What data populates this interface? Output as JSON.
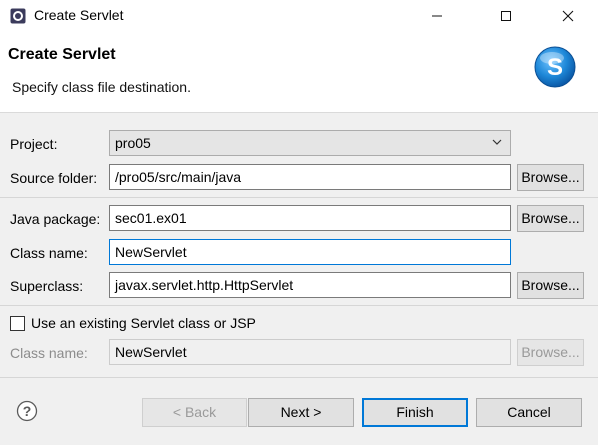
{
  "window": {
    "title": "Create Servlet",
    "app_icon": "eclipse-icon",
    "controls": [
      "minimize-icon",
      "maximize-icon",
      "close-icon"
    ]
  },
  "header": {
    "title": "Create Servlet",
    "description": "Specify class file destination.",
    "logo_icon": "servlet-wizard-logo-icon",
    "logo_letter": "S"
  },
  "form": {
    "project": {
      "label": "Project:",
      "value": "pro05"
    },
    "source_folder": {
      "label": "Source folder:",
      "value": "/pro05/src/main/java",
      "browse_label": "Browse..."
    },
    "java_package": {
      "label": "Java package:",
      "value": "sec01.ex01",
      "browse_label": "Browse..."
    },
    "class_name": {
      "label": "Class name:",
      "value": "NewServlet"
    },
    "superclass": {
      "label": "Superclass:",
      "value": "javax.servlet.http.HttpServlet",
      "browse_label": "Browse..."
    },
    "use_existing": {
      "label": "Use an existing Servlet class or JSP",
      "checked": false
    },
    "existing_class": {
      "label": "Class name:",
      "value": "NewServlet",
      "browse_label": "Browse..."
    }
  },
  "footer": {
    "help_icon": "help-icon",
    "back_label": "< Back",
    "next_label": "Next >",
    "finish_label": "Finish",
    "cancel_label": "Cancel"
  },
  "colors": {
    "accent": "#0078d7",
    "logo_blue": "#1e88d8",
    "background": "#f0f0f0"
  }
}
